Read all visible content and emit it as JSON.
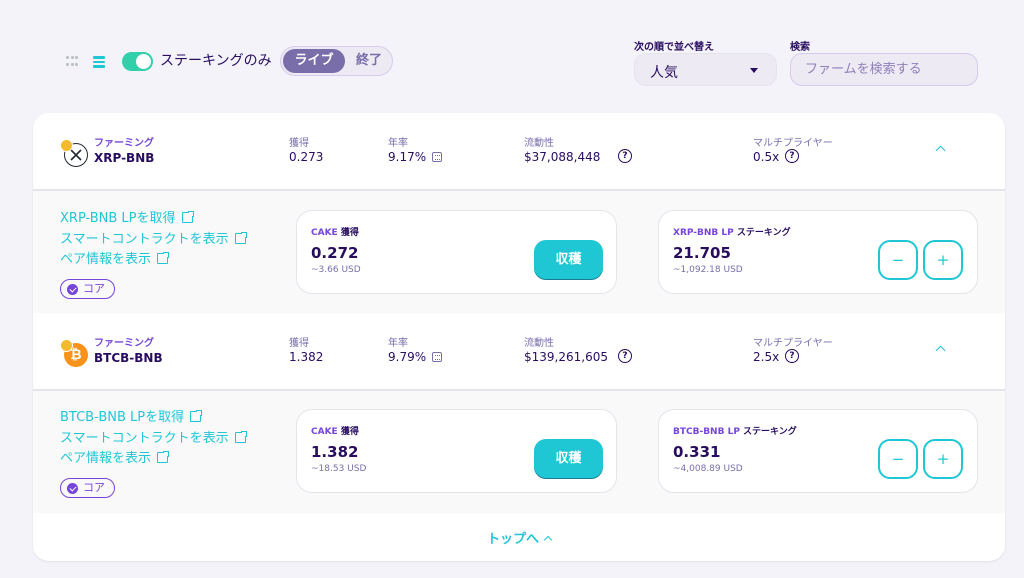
{
  "controls": {
    "staked_only_label": "ステーキングのみ",
    "tab_live": "ライブ",
    "tab_finished": "終了",
    "sort_label": "次の順で並べ替え",
    "sort_value": "人気",
    "search_label": "検索",
    "search_placeholder": "ファームを検索する"
  },
  "farms": [
    {
      "tag": "ファーミング",
      "name": "XRP-BNB",
      "earned_label": "獲得",
      "earned": "0.273",
      "apr_label": "年率",
      "apr": "9.17%",
      "liquidity_label": "流動性",
      "liquidity": "$37,088,448",
      "multiplier_label": "マルチプライヤー",
      "multiplier": "0.5x",
      "links": [
        "XRP-BNB LPを取得",
        "スマートコントラクトを表示",
        "ペア情報を表示"
      ],
      "badge": "コア",
      "harvest_label_token": "CAKE",
      "harvest_label_suffix": " 獲得",
      "harvest_value": "0.272",
      "harvest_usd": "~3.66 USD",
      "harvest_button": "収穫",
      "stake_label_token": "XRP-BNB LP",
      "stake_label_suffix": " ステーキング",
      "stake_value": "21.705",
      "stake_usd": "~1,092.18 USD",
      "minus": "−",
      "plus": "+"
    },
    {
      "tag": "ファーミング",
      "name": "BTCB-BNB",
      "earned_label": "獲得",
      "earned": "1.382",
      "apr_label": "年率",
      "apr": "9.79%",
      "liquidity_label": "流動性",
      "liquidity": "$139,261,605",
      "multiplier_label": "マルチプライヤー",
      "multiplier": "2.5x",
      "links": [
        "BTCB-BNB LPを取得",
        "スマートコントラクトを表示",
        "ペア情報を表示"
      ],
      "badge": "コア",
      "harvest_label_token": "CAKE",
      "harvest_label_suffix": " 獲得",
      "harvest_value": "1.382",
      "harvest_usd": "~18.53 USD",
      "harvest_button": "収穫",
      "stake_label_token": "BTCB-BNB LP",
      "stake_label_suffix": " ステーキング",
      "stake_value": "0.331",
      "stake_usd": "~4,008.89 USD",
      "minus": "−",
      "plus": "+"
    }
  ],
  "footer": {
    "to_top": "トップへ"
  },
  "icons": {
    "help": "?",
    "btc_symbol": "₿"
  },
  "colors": {
    "primary": "#1fc7d4",
    "secondary": "#7645d9",
    "text": "#280d5f",
    "success": "#31d0aa"
  }
}
